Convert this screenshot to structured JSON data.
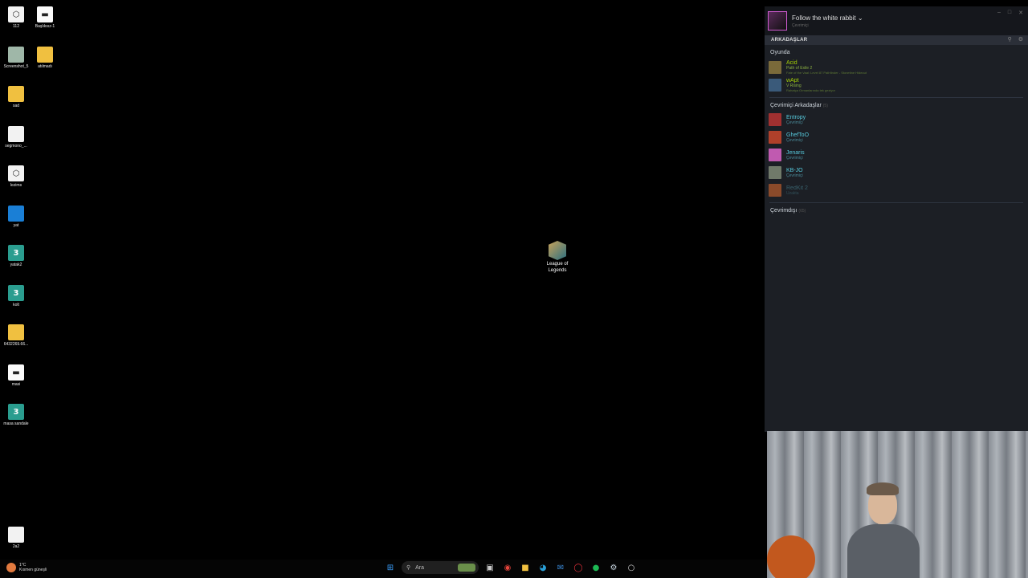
{
  "desktop": {
    "icons": [
      {
        "label": "112",
        "icon": "app-hex-icon"
      },
      {
        "label": "Başlıksız-1",
        "icon": "image-file-icon"
      },
      {
        "label": "Screenshot_5",
        "icon": "screenshot-icon"
      },
      {
        "label": "atılmadı",
        "icon": "folder-icon"
      },
      {
        "label": "sad",
        "icon": "folder-icon"
      },
      {
        "label": "segmono_...",
        "icon": "file-icon"
      },
      {
        "label": "lezims",
        "icon": "app-hex-icon"
      },
      {
        "label": "yat",
        "icon": "shield-app-icon"
      },
      {
        "label": "yatak2",
        "icon": "3dsmax-file-icon"
      },
      {
        "label": "kolt",
        "icon": "3dsmax-file-icon"
      },
      {
        "label": "6432269.66...",
        "icon": "folder-icon"
      },
      {
        "label": "masi",
        "icon": "image-file-icon"
      },
      {
        "label": "masa sandale",
        "icon": "3dsmax-file-icon"
      },
      {
        "label": "2a2",
        "icon": "file-icon"
      }
    ],
    "lol_shortcut": {
      "line1": "League of",
      "line2": "Legends"
    }
  },
  "friends_panel": {
    "username": "Follow the white rabbit ⌄",
    "user_status": "Çevrimiçi",
    "window_controls": {
      "minimize": "–",
      "maximize": "□",
      "close": "✕"
    },
    "tab_label": "ARKADAŞLAR",
    "in_game_title": "Oyunda",
    "in_game": [
      {
        "name": "Acid",
        "game": "Path of Exile 2",
        "detail": "Fate of the Vaal: Level 87 Pathfinder - Stonetine Hideout",
        "color": "#7a6a3a"
      },
      {
        "name": "wApt",
        "game": "V Rising",
        "detail": "Rahatça Ormanlarında tek geziyor",
        "color": "#3a5a7a"
      }
    ],
    "online_title": "Çevrimiçi Arkadaşlar",
    "online_count": "(5)",
    "online": [
      {
        "name": "Entropy",
        "status": "Çevrimiçi",
        "color": "#a03030",
        "away": false
      },
      {
        "name": "GhefToO",
        "status": "Çevrimiçi",
        "color": "#b0402a",
        "away": false
      },
      {
        "name": "Jenaris",
        "status": "Çevrimiçi",
        "color": "#c05ab0",
        "away": false
      },
      {
        "name": "KB-JO",
        "status": "Çevrimiçi",
        "color": "#707a6a",
        "away": false
      },
      {
        "name": "RedKit 2",
        "status": "Uzakta",
        "color": "#8a4a2a",
        "away": true
      }
    ],
    "offline_title": "Çevrimdışı",
    "offline_count": "(65)"
  },
  "taskbar": {
    "weather_temp": "1°C",
    "weather_desc": "Kısmen güneşli",
    "search_placeholder": "Ara"
  }
}
